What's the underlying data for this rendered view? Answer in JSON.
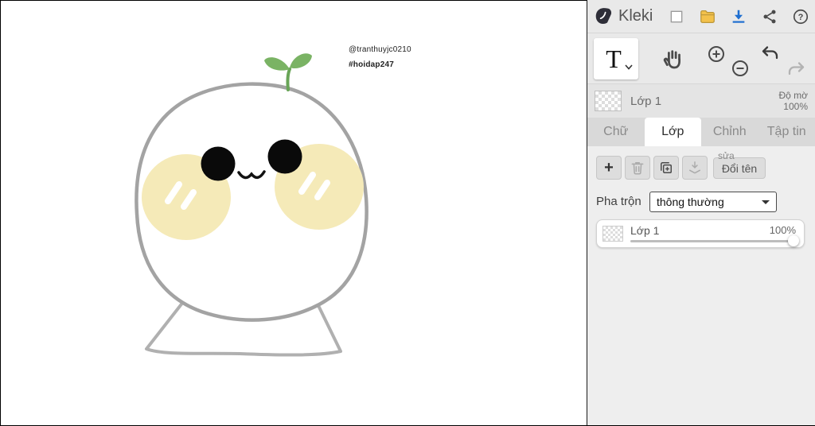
{
  "app": {
    "name": "Kleki"
  },
  "canvas": {
    "annotation_handle": "@tranthuyjc0210",
    "annotation_hashtag": "#hoidap247"
  },
  "topbar": {
    "logo_text": "Kleki",
    "help_label": "?"
  },
  "toolbar": {
    "text_tool_label": "T"
  },
  "layer_preview": {
    "name": "Lớp 1",
    "opacity_label": "Độ mờ",
    "opacity_value": "100%"
  },
  "tabs": [
    {
      "label": "Chữ",
      "active": false
    },
    {
      "label": "Lớp",
      "active": true
    },
    {
      "label": "Chỉnh",
      "active": false
    },
    {
      "label": "Tập tin",
      "active": false
    }
  ],
  "layers_panel": {
    "add_label": "+",
    "edit_hint_label": "sửa",
    "rename_label": "Đổi tên",
    "blend_label": "Pha trộn",
    "blend_value": "thông thường",
    "layers": [
      {
        "name": "Lớp 1",
        "opacity": "100%"
      }
    ]
  },
  "icons": [
    "kleki-logo-icon",
    "new-file-icon",
    "open-folder-icon",
    "download-icon",
    "share-icon",
    "help-icon",
    "text-tool-icon",
    "hand-tool-icon",
    "zoom-in-icon",
    "zoom-out-icon",
    "undo-icon",
    "redo-icon",
    "add-layer-icon",
    "trash-icon",
    "duplicate-layer-icon",
    "merge-down-icon"
  ],
  "colors": {
    "download_blue": "#1f6fd0",
    "folder_yellow": "#f3c14b",
    "folder_stroke": "#bb973a",
    "sprout_green": "#7ab364",
    "sprout_stem": "#69a557",
    "cheek_yellow": "#f5eab8",
    "outline_gray": "#a3a3a3"
  }
}
